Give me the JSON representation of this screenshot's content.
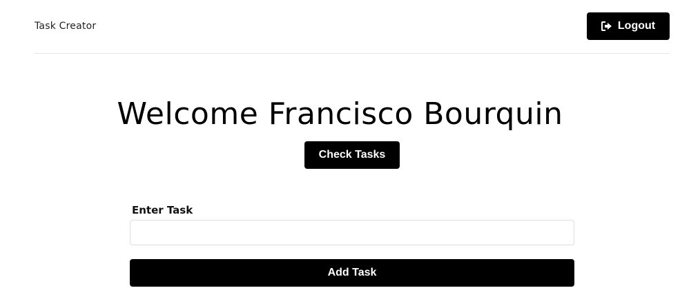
{
  "navbar": {
    "brand": "Task Creator",
    "logout_label": "Logout",
    "logout_icon": "sign-out-icon"
  },
  "main": {
    "welcome_text": "Welcome Francisco Bourquin",
    "check_tasks_label": "Check Tasks"
  },
  "form": {
    "task_label": "Enter Task",
    "task_value": "",
    "task_placeholder": "",
    "add_task_label": "Add Task"
  },
  "colors": {
    "button_bg": "#000000",
    "button_text": "#ffffff",
    "divider": "#e6e6e6"
  }
}
